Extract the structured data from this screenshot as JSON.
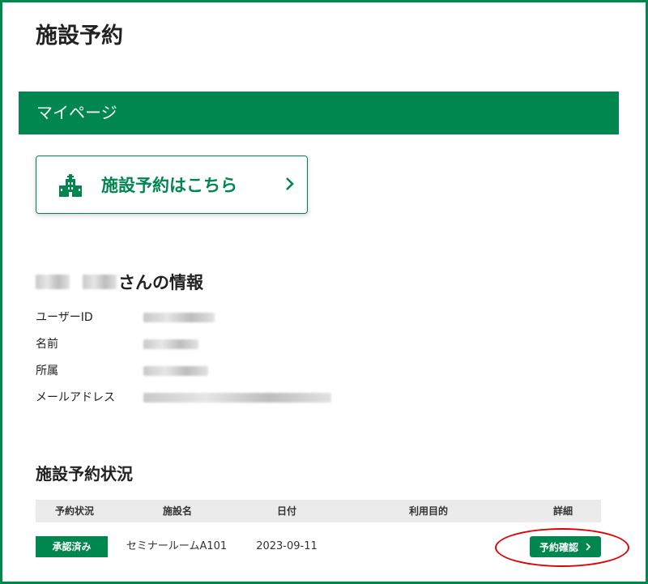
{
  "page": {
    "title": "施設予約"
  },
  "mypage": {
    "label": "マイページ"
  },
  "reserve_card": {
    "label": "施設予約はこちら",
    "icon": "facility-building-icon"
  },
  "user_info": {
    "heading_suffix": "さんの情報",
    "fields": [
      {
        "label": "ユーザーID"
      },
      {
        "label": "名前"
      },
      {
        "label": "所属"
      },
      {
        "label": "メールアドレス"
      }
    ]
  },
  "reservations": {
    "heading": "施設予約状況",
    "columns": [
      "予約状況",
      "施設名",
      "日付",
      "利用目的",
      "詳細"
    ],
    "rows": [
      {
        "status": "承認済み",
        "facility": "セミナールームA101",
        "date": "2023-09-11",
        "purpose": "",
        "detail_label": "予約確認"
      }
    ]
  },
  "colors": {
    "brand": "#00864f",
    "annotation": "#e00000",
    "header_bg": "#ebebeb"
  }
}
